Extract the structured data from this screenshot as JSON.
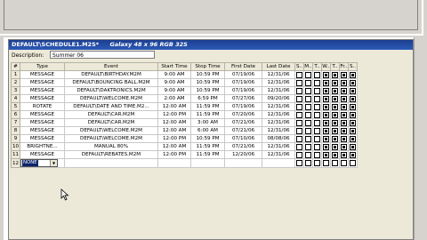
{
  "window": {
    "title": "DEFAULT\\SCHEDULE1.M2S*",
    "spec": "Galaxy 48 x 96 RGB 32S"
  },
  "description": {
    "label": "Description:",
    "value": "Summer 06"
  },
  "table": {
    "headers": [
      "#",
      "Type",
      "Event",
      "Start Time",
      "Stop Time",
      "First Date",
      "Last Date",
      "S..",
      "M..",
      "T..",
      "W..",
      "T..",
      "Fr..",
      "S.."
    ],
    "rows": [
      {
        "num": "1",
        "type": "MESSAGE",
        "event": "DEFAULT\\BIRTHDAY.M2M",
        "start": "9:00 AM",
        "stop": "10:59 PM",
        "first": "07/19/06",
        "last": "12/31/06",
        "days": [
          false,
          false,
          false,
          true,
          true,
          true,
          true
        ]
      },
      {
        "num": "2",
        "type": "MESSAGE",
        "event": "DEFAULT\\BOUNCING BALL.M2M",
        "start": "9:00 AM",
        "stop": "10:59 PM",
        "first": "07/19/06",
        "last": "12/31/06",
        "days": [
          false,
          false,
          false,
          true,
          true,
          true,
          true
        ]
      },
      {
        "num": "3",
        "type": "MESSAGE",
        "event": "DEFAULT\\DAKTRONICS.M2M",
        "start": "9:00 AM",
        "stop": "10:59 PM",
        "first": "07/19/06",
        "last": "12/31/06",
        "days": [
          false,
          false,
          false,
          true,
          true,
          true,
          true
        ]
      },
      {
        "num": "4",
        "type": "MESSAGE",
        "event": "DEFAULT\\WELCOME.M2M",
        "start": "2:00 AM",
        "stop": "6:59 PM",
        "first": "07/27/06",
        "last": "09/20/06",
        "days": [
          false,
          false,
          false,
          true,
          true,
          true,
          true
        ]
      },
      {
        "num": "5",
        "type": "ROTATE",
        "event": "DEFAULT\\DATE AND TIME.M2...",
        "start": "12:00 AM",
        "stop": "11:59 PM",
        "first": "07/19/06",
        "last": "12/31/06",
        "days": [
          false,
          false,
          false,
          true,
          true,
          true,
          true
        ]
      },
      {
        "num": "6",
        "type": "MESSAGE",
        "event": "DEFAULT\\CAR.M2M",
        "start": "12:00 PM",
        "stop": "11:59 PM",
        "first": "07/20/06",
        "last": "12/31/06",
        "days": [
          false,
          false,
          false,
          true,
          true,
          true,
          true
        ]
      },
      {
        "num": "7",
        "type": "MESSAGE",
        "event": "DEFAULT\\CAR.M2M",
        "start": "12:00 AM",
        "stop": "3:00 AM",
        "first": "07/21/06",
        "last": "12/31/06",
        "days": [
          false,
          false,
          false,
          true,
          true,
          true,
          true
        ]
      },
      {
        "num": "8",
        "type": "MESSAGE",
        "event": "DEFAULT\\WELCOME.M2M",
        "start": "12:00 AM",
        "stop": "6:00 AM",
        "first": "07/21/06",
        "last": "12/31/06",
        "days": [
          false,
          false,
          false,
          true,
          true,
          true,
          true
        ]
      },
      {
        "num": "9",
        "type": "MESSAGE",
        "event": "DEFAULT\\WELCOME.M2M",
        "start": "12:00 PM",
        "stop": "10:59 PM",
        "first": "07/10/06",
        "last": "08/08/06",
        "days": [
          false,
          false,
          false,
          true,
          true,
          true,
          true
        ]
      },
      {
        "num": "10",
        "type": "BRIGHTNE...",
        "event": "MANUAL 80%",
        "start": "12:00 AM",
        "stop": "11:59 PM",
        "first": "07/21/06",
        "last": "12/31/06",
        "days": [
          false,
          false,
          false,
          true,
          true,
          true,
          true
        ]
      },
      {
        "num": "11",
        "type": "MESSAGE",
        "event": "DEFAULT\\REBATES.M2M",
        "start": "12:00 PM",
        "stop": "11:59 PM",
        "first": "12/20/06",
        "last": "12/31/06",
        "days": [
          false,
          false,
          false,
          true,
          true,
          true,
          true
        ]
      },
      {
        "num": "12",
        "type": "",
        "event": "",
        "start": "",
        "stop": "",
        "first": "",
        "last": "",
        "days": [
          false,
          false,
          false,
          false,
          false,
          false,
          false
        ]
      }
    ],
    "new_row_type": "NONE"
  }
}
